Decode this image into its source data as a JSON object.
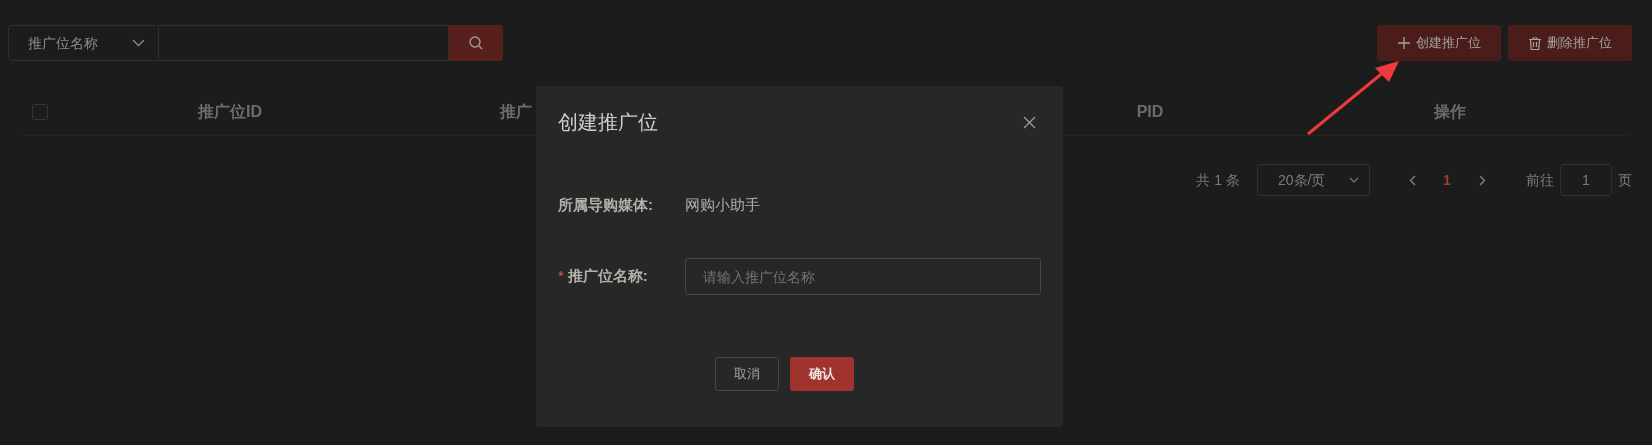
{
  "search": {
    "field_select": "推广位名称"
  },
  "actions": [
    {
      "kind": "create",
      "label": "创建推广位"
    },
    {
      "kind": "delete",
      "label": "删除推广位"
    }
  ],
  "table": {
    "select_all": {
      "checked": false
    },
    "columns": [
      "推广位ID",
      "推广",
      "PID",
      "操作"
    ]
  },
  "pagination": {
    "total": "共 1 条",
    "page_size": "20条/页",
    "pages": [
      {
        "label": "1",
        "selected": true
      }
    ],
    "goto_label": "前往",
    "goto_value": "1",
    "goto_suffix": "页"
  },
  "dialog": {
    "title": "创建推广位",
    "fields": [
      {
        "kind": "static",
        "label": "所属导购媒体:",
        "required": false,
        "value": "网购小助手"
      },
      {
        "kind": "input",
        "label": "推广位名称:",
        "required": true,
        "required_mark": "*",
        "placeholder": "请输入推广位名称"
      }
    ],
    "buttons": [
      {
        "kind": "secondary",
        "label": "取消"
      },
      {
        "kind": "primary",
        "label": "确认"
      }
    ]
  }
}
